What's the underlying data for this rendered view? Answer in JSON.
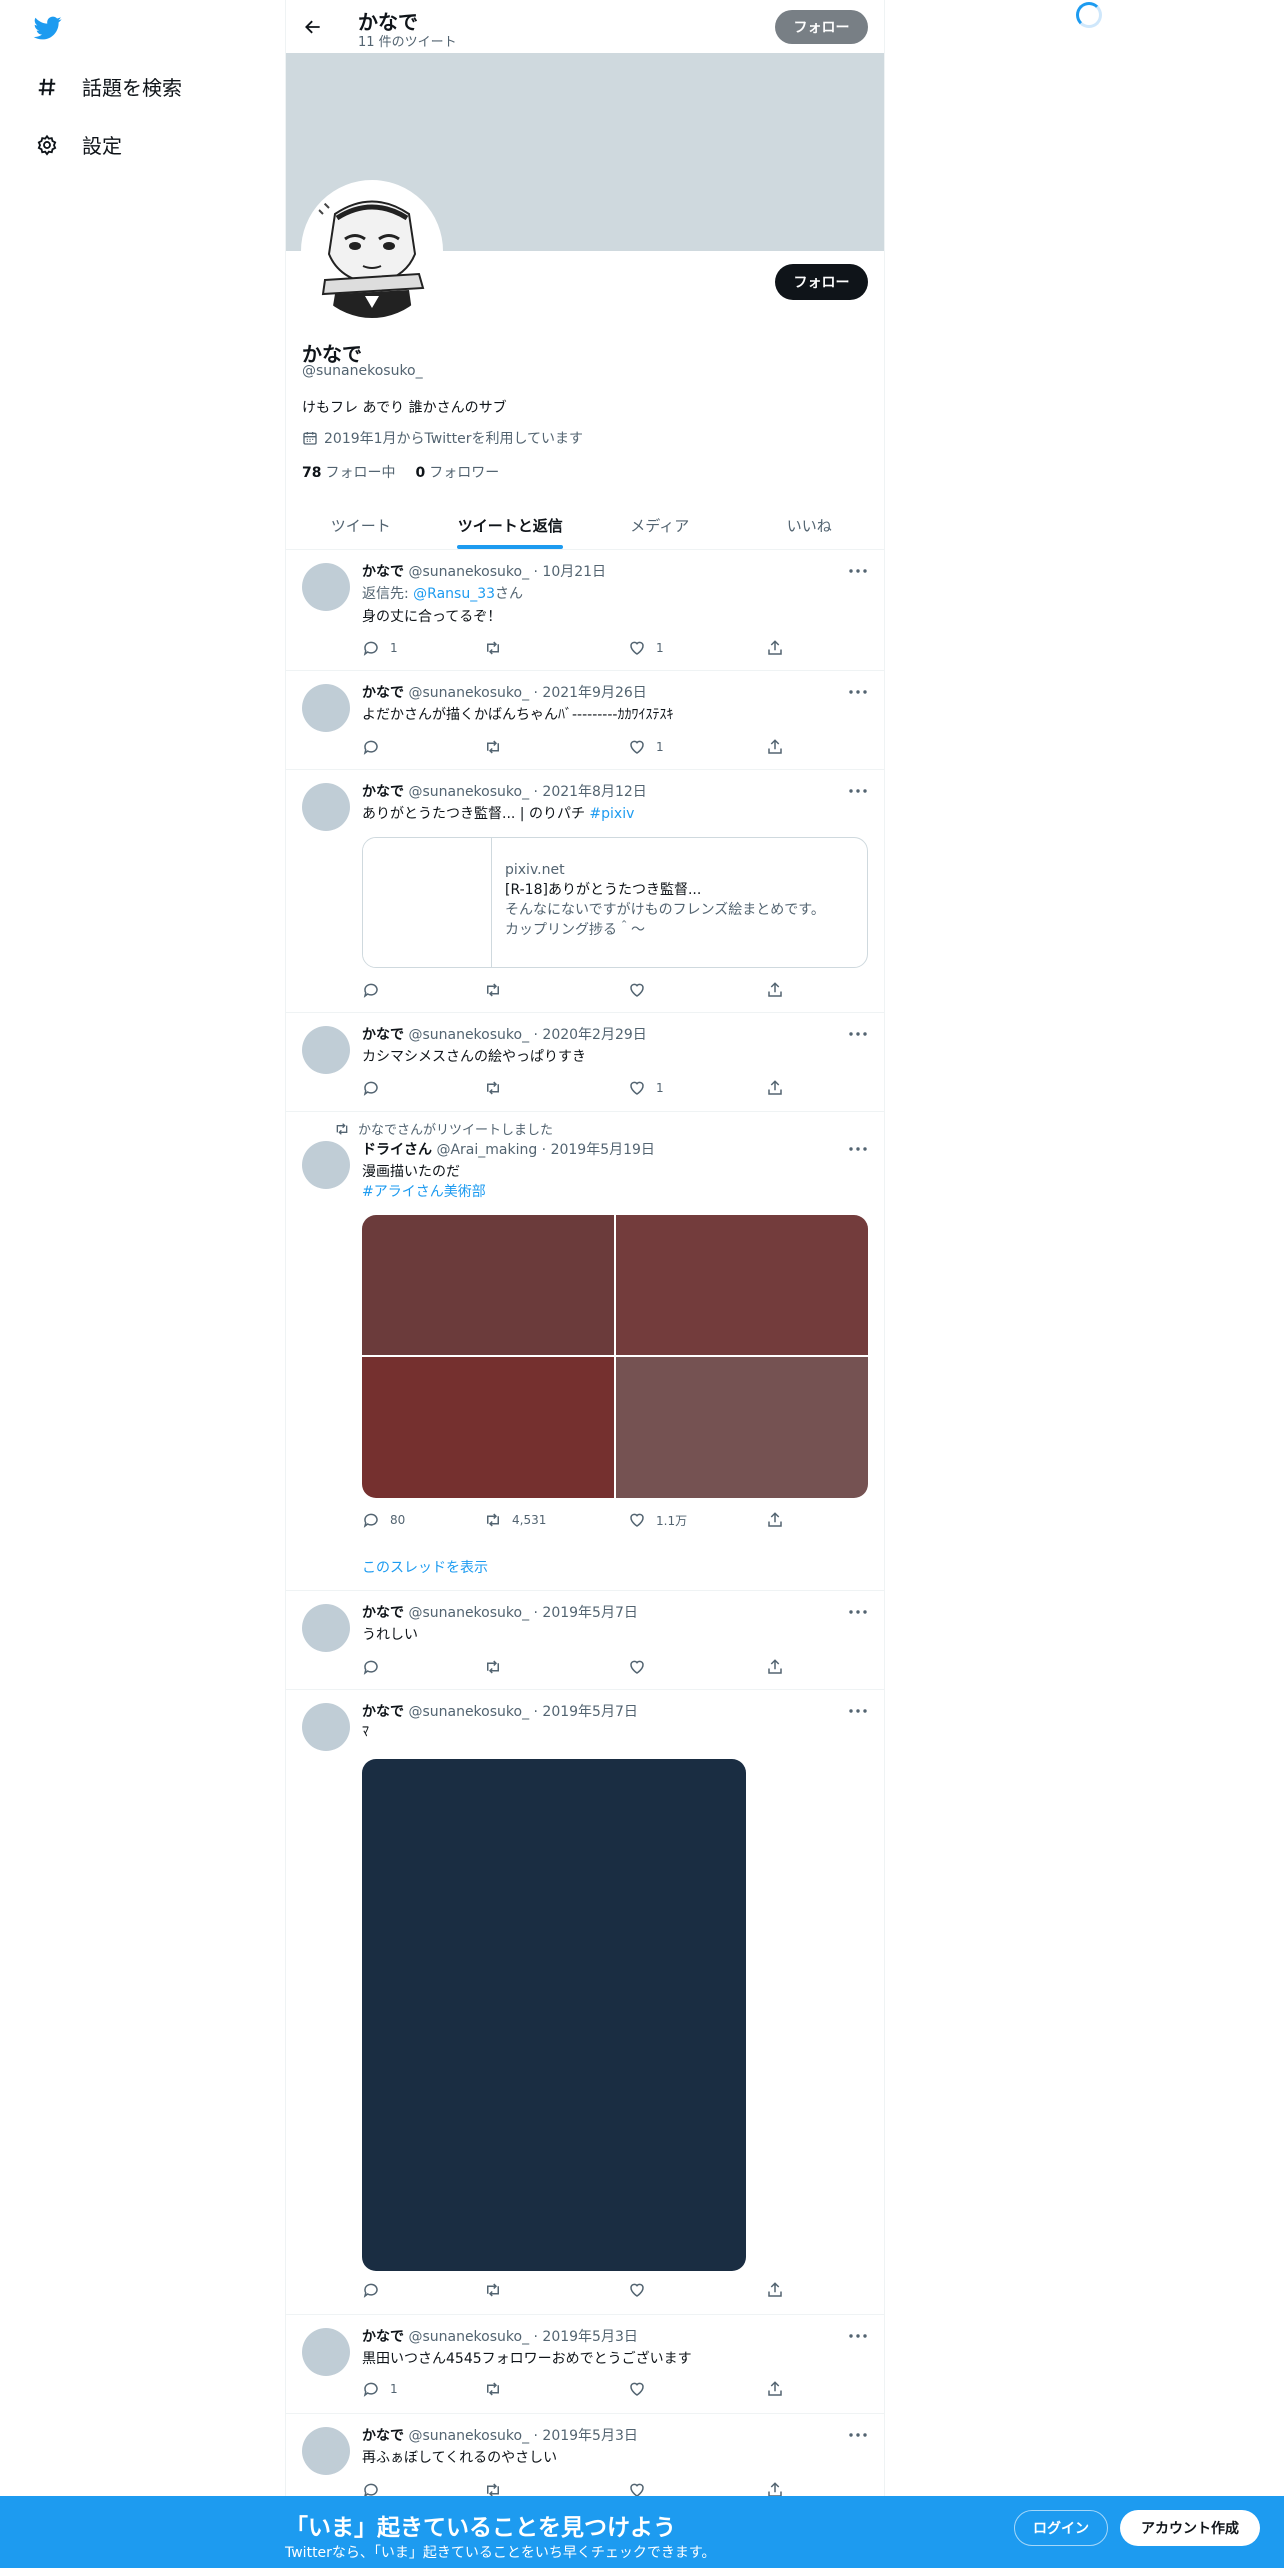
{
  "nav": {
    "items": [
      {
        "label": "話題を検索",
        "icon": "hashtag-icon"
      },
      {
        "label": "設定",
        "icon": "gear-icon"
      }
    ]
  },
  "header": {
    "name": "かなで",
    "tweet_count": "11 件のツイート",
    "follow_label": "フォロー"
  },
  "profile": {
    "follow_label": "フォロー",
    "name": "かなで",
    "handle": "@sunanekosuko_",
    "bio": "けもフレ あでり 誰かさんのサブ",
    "joined": "2019年1月からTwitterを利用しています",
    "following_count": "78",
    "following_label": "フォロー中",
    "followers_count": "0",
    "followers_label": "フォロワー"
  },
  "tabs": [
    "ツイート",
    "ツイートと返信",
    "メディア",
    "いいね"
  ],
  "tweets": [
    {
      "name": "かなで",
      "meta": "@sunanekosuko_ · 10月21日",
      "reply_prefix": "返信先: ",
      "reply_to": "@Ransu_33",
      "reply_suffix": "さん",
      "text": "身の丈に合ってるぞ！",
      "replies": "1",
      "retweets": "",
      "likes": "1"
    },
    {
      "name": "かなで",
      "meta": "@sunanekosuko_ · 2021年9月26日",
      "text": "よだかさんが描くかばんちゃんﾊﾞ---------ｶｶﾜｲｽﾃｽｷ",
      "replies": "",
      "retweets": "",
      "likes": "1"
    },
    {
      "name": "かなで",
      "meta": "@sunanekosuko_ · 2021年8月12日",
      "text": "ありがとうたつき監督... | のりパチ ",
      "tag": "#pixiv",
      "card": {
        "domain": "pixiv.net",
        "title": "[R-18]ありがとうたつき監督...",
        "desc1": "そんなにないですがけものフレンズ絵まとめです。",
        "desc2": "カップリング捗る＾～"
      },
      "replies": "",
      "retweets": "",
      "likes": ""
    },
    {
      "name": "かなで",
      "meta": "@sunanekosuko_ · 2020年2月29日",
      "text": "カシマシメスさんの絵やっぱりすき",
      "replies": "",
      "retweets": "",
      "likes": "1"
    },
    {
      "retweet_label": "かなでさんがリツイートしました",
      "name": "ドライさん",
      "meta": "@Arai_making · 2019年5月19日",
      "text": "漫画描いたのだ",
      "tag": "#アライさん美術部",
      "media_colors": [
        "#6b3b3b",
        "#733c3c",
        "#75302f",
        "#755252"
      ],
      "replies": "80",
      "retweets": "4,531",
      "likes": "1.1万",
      "show_thread": "このスレッドを表示"
    },
    {
      "name": "かなで",
      "meta": "@sunanekosuko_ · 2019年5月7日",
      "text": "うれしい",
      "replies": "",
      "retweets": "",
      "likes": ""
    },
    {
      "name": "かなで",
      "meta": "@sunanekosuko_ · 2019年5月7日",
      "text": "ﾏ",
      "media_color": "#1a2d42",
      "replies": "",
      "retweets": "",
      "likes": ""
    },
    {
      "name": "かなで",
      "meta": "@sunanekosuko_ · 2019年5月3日",
      "text": "黒田いつさん4545フォロワーおめでとうございます",
      "replies": "1",
      "retweets": "",
      "likes": ""
    },
    {
      "name": "かなで",
      "meta": "@sunanekosuko_ · 2019年5月3日",
      "text": "再ふぁぼしてくれるのやさしい",
      "replies": "",
      "retweets": "",
      "likes": ""
    }
  ],
  "bottom_bar": {
    "title": "「いま」起きていることを見つけよう",
    "subtitle": "Twitterなら、「いま」起きていることをいち早くチェックできます。",
    "login": "ログイン",
    "signup": "アカウント作成"
  },
  "colors": {
    "accent": "#1d9bf0",
    "text": "#0f1419",
    "muted": "#536471",
    "banner": "#cfd9de"
  }
}
